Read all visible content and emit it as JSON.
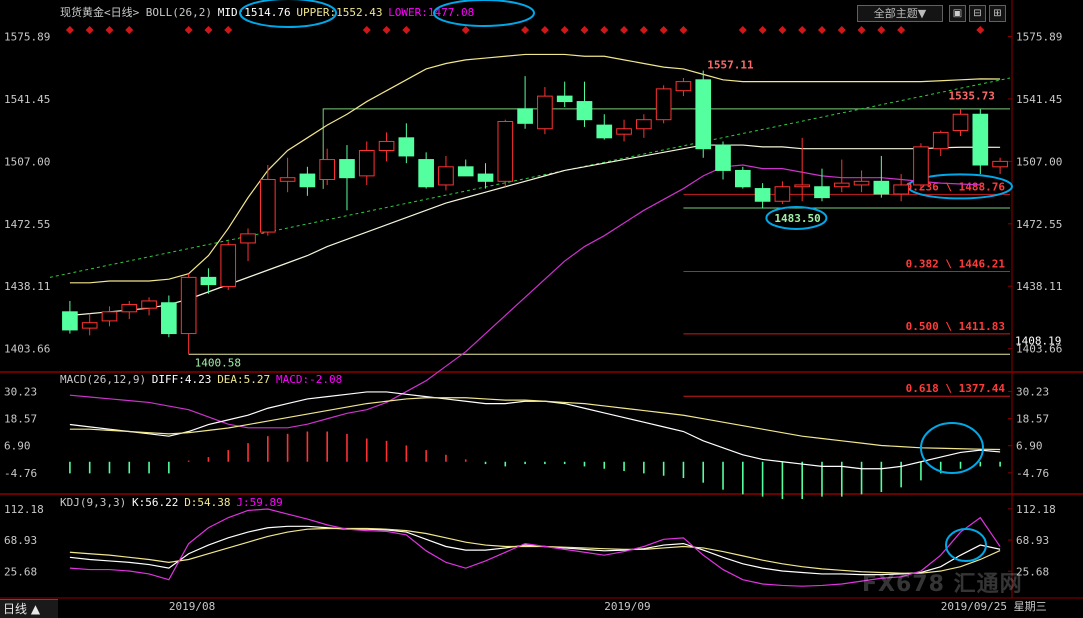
{
  "window": {
    "theme_button": "全部主题▼",
    "period_tab": "日线 ▲",
    "watermark": "FX678 汇通网"
  },
  "chart_data": {
    "type": "candlestick",
    "instrument": "现货黄金",
    "period": "日线",
    "header": {
      "main": [
        "现货黄金<日线>",
        "BOLL(26,2)",
        "MID:1514.76",
        "UPPER:1552.43",
        "LOWER:1477.08"
      ],
      "macd": [
        "MACD(26,12,9)",
        "DIFF:4.23",
        "DEA:5.27",
        "MACD:-2.08"
      ],
      "kdj": [
        "KDJ(9,3,3)",
        "K:56.22",
        "D:54.38",
        "J:59.89"
      ]
    },
    "price_axis": {
      "ylim": [
        1393,
        1585
      ],
      "ticks": [
        1575.89,
        1541.45,
        1507.0,
        1472.55,
        1438.11,
        1403.66
      ],
      "tick_labels": [
        "1575.89",
        "1541.45",
        "1507.00",
        "1472.55",
        "1438.11",
        "1403.66"
      ]
    },
    "candles": [
      {
        "o": 1424.0,
        "h": 1430.0,
        "l": 1412.0,
        "c": 1414.0
      },
      {
        "o": 1415.0,
        "h": 1423.0,
        "l": 1411.0,
        "c": 1418.0
      },
      {
        "o": 1419.0,
        "h": 1427.0,
        "l": 1416.0,
        "c": 1424.0
      },
      {
        "o": 1424.0,
        "h": 1430.0,
        "l": 1420.0,
        "c": 1428.0
      },
      {
        "o": 1426.0,
        "h": 1432.0,
        "l": 1422.0,
        "c": 1430.0
      },
      {
        "o": 1429.0,
        "h": 1433.0,
        "l": 1410.0,
        "c": 1412.0
      },
      {
        "o": 1412.0,
        "h": 1445.0,
        "l": 1400.6,
        "c": 1443.0
      },
      {
        "o": 1443.0,
        "h": 1448.0,
        "l": 1434.0,
        "c": 1439.0
      },
      {
        "o": 1438.0,
        "h": 1463.0,
        "l": 1436.0,
        "c": 1461.0
      },
      {
        "o": 1462.0,
        "h": 1470.0,
        "l": 1452.0,
        "c": 1467.0
      },
      {
        "o": 1468.0,
        "h": 1505.0,
        "l": 1466.0,
        "c": 1497.0
      },
      {
        "o": 1496.0,
        "h": 1509.0,
        "l": 1490.0,
        "c": 1498.0
      },
      {
        "o": 1500.0,
        "h": 1504.0,
        "l": 1488.0,
        "c": 1493.0
      },
      {
        "o": 1497.0,
        "h": 1514.0,
        "l": 1494.0,
        "c": 1508.0
      },
      {
        "o": 1508.0,
        "h": 1516.0,
        "l": 1480.0,
        "c": 1498.0
      },
      {
        "o": 1499.0,
        "h": 1518.0,
        "l": 1494.0,
        "c": 1513.0
      },
      {
        "o": 1513.0,
        "h": 1523.0,
        "l": 1507.0,
        "c": 1518.0
      },
      {
        "o": 1520.0,
        "h": 1528.0,
        "l": 1506.0,
        "c": 1510.0
      },
      {
        "o": 1508.0,
        "h": 1512.0,
        "l": 1492.0,
        "c": 1493.0
      },
      {
        "o": 1494.0,
        "h": 1510.0,
        "l": 1491.0,
        "c": 1504.0
      },
      {
        "o": 1504.0,
        "h": 1508.0,
        "l": 1499.0,
        "c": 1499.0
      },
      {
        "o": 1500.0,
        "h": 1506.0,
        "l": 1492.0,
        "c": 1496.0
      },
      {
        "o": 1496.0,
        "h": 1530.0,
        "l": 1493.0,
        "c": 1529.0
      },
      {
        "o": 1536.0,
        "h": 1554.0,
        "l": 1525.0,
        "c": 1528.0
      },
      {
        "o": 1525.0,
        "h": 1548.0,
        "l": 1522.0,
        "c": 1543.0
      },
      {
        "o": 1543.0,
        "h": 1551.0,
        "l": 1537.0,
        "c": 1540.0
      },
      {
        "o": 1540.0,
        "h": 1551.0,
        "l": 1526.0,
        "c": 1530.0
      },
      {
        "o": 1527.0,
        "h": 1533.0,
        "l": 1519.0,
        "c": 1520.0
      },
      {
        "o": 1522.0,
        "h": 1530.0,
        "l": 1518.0,
        "c": 1525.0
      },
      {
        "o": 1525.0,
        "h": 1533.0,
        "l": 1520.0,
        "c": 1530.0
      },
      {
        "o": 1530.0,
        "h": 1549.0,
        "l": 1528.0,
        "c": 1547.0
      },
      {
        "o": 1546.0,
        "h": 1553.0,
        "l": 1543.0,
        "c": 1551.0
      },
      {
        "o": 1552.0,
        "h": 1557.1,
        "l": 1509.0,
        "c": 1514.0
      },
      {
        "o": 1516.0,
        "h": 1518.0,
        "l": 1497.0,
        "c": 1502.0
      },
      {
        "o": 1502.0,
        "h": 1504.0,
        "l": 1492.0,
        "c": 1493.0
      },
      {
        "o": 1492.0,
        "h": 1495.0,
        "l": 1481.0,
        "c": 1485.0
      },
      {
        "o": 1485.0,
        "h": 1496.0,
        "l": 1483.5,
        "c": 1493.0
      },
      {
        "o": 1493.0,
        "h": 1520.0,
        "l": 1485.0,
        "c": 1494.0
      },
      {
        "o": 1493.0,
        "h": 1503.0,
        "l": 1485.0,
        "c": 1487.0
      },
      {
        "o": 1493.0,
        "h": 1508.0,
        "l": 1490.0,
        "c": 1495.0
      },
      {
        "o": 1494.0,
        "h": 1502.0,
        "l": 1490.0,
        "c": 1496.0
      },
      {
        "o": 1496.0,
        "h": 1510.0,
        "l": 1487.0,
        "c": 1489.0
      },
      {
        "o": 1489.0,
        "h": 1500.0,
        "l": 1485.0,
        "c": 1494.0
      },
      {
        "o": 1494.0,
        "h": 1517.0,
        "l": 1492.0,
        "c": 1515.0
      },
      {
        "o": 1514.0,
        "h": 1524.0,
        "l": 1510.0,
        "c": 1523.0
      },
      {
        "o": 1524.0,
        "h": 1535.7,
        "l": 1521.0,
        "c": 1533.0
      },
      {
        "o": 1533.0,
        "h": 1536.0,
        "l": 1500.0,
        "c": 1505.0
      },
      {
        "o": 1504.0,
        "h": 1509.0,
        "l": 1500.0,
        "c": 1507.0
      }
    ],
    "boll": {
      "mid": [
        1422,
        1423,
        1424,
        1425,
        1426,
        1428,
        1431,
        1435,
        1439,
        1443,
        1447,
        1451,
        1455,
        1460,
        1464,
        1468,
        1472,
        1476,
        1480,
        1484,
        1487,
        1490,
        1493,
        1496,
        1499,
        1502,
        1504,
        1506,
        1508,
        1510,
        1512,
        1514,
        1516,
        1516,
        1516,
        1515,
        1515,
        1514,
        1514,
        1514,
        1514,
        1514,
        1514,
        1514,
        1514.5,
        1514.8,
        1514.8,
        1514.76
      ],
      "upper": [
        1440,
        1440,
        1441,
        1441,
        1441,
        1442,
        1445,
        1455,
        1470,
        1487,
        1502,
        1513,
        1520,
        1527,
        1533,
        1540,
        1546,
        1552,
        1558,
        1561,
        1563,
        1564,
        1565,
        1566,
        1566,
        1566,
        1565,
        1565,
        1563,
        1561,
        1559,
        1558,
        1555,
        1552,
        1551,
        1551,
        1551,
        1551,
        1551,
        1551,
        1551,
        1551,
        1551,
        1551,
        1551.5,
        1552,
        1552.5,
        1552.43
      ],
      "lower": [
        1378,
        1377,
        1376,
        1375,
        1374,
        1372,
        1370,
        1366,
        1362,
        1360,
        1360,
        1360,
        1362,
        1365,
        1368,
        1370,
        1374,
        1380,
        1386,
        1394,
        1402,
        1412,
        1422,
        1432,
        1442,
        1452,
        1460,
        1466,
        1473,
        1480,
        1486,
        1492,
        1499,
        1504,
        1505,
        1503,
        1503,
        1501,
        1499,
        1498,
        1498,
        1498,
        1497,
        1496,
        1495,
        1494.5,
        1494,
        1477.08
      ]
    },
    "boll_lower_display_offset": 0,
    "annotations": {
      "high": {
        "label": "1557.11",
        "value": 1557.11,
        "bar": 32
      },
      "swing_high": {
        "label": "1535.73",
        "value": 1535.73,
        "bar": 45
      },
      "low": {
        "label": "1400.58",
        "value": 1400.58,
        "bar": 6
      },
      "swing_low": {
        "label": "1483.50",
        "value": 1483.5,
        "bar": 36
      },
      "current_price": {
        "label": "1408.19",
        "value": 1408.19
      },
      "fib_levels": [
        {
          "label": "0.236 \\ 1488.76",
          "value": 1488.76
        },
        {
          "label": "0.382 \\ 1446.21",
          "value": 1446.21
        },
        {
          "label": "0.500 \\ 1411.83",
          "value": 1411.83
        },
        {
          "label": "0.618 \\ 1377.44",
          "value": 1377.44
        }
      ],
      "box_top": 1536.0,
      "box_bottom": 1483.5,
      "trendline": [
        [
          0,
          1443.0
        ],
        [
          47,
          1553.0
        ]
      ]
    },
    "macd_axis": {
      "ylim": [
        -13,
        36
      ],
      "ticks": [
        30.23,
        18.57,
        6.9,
        -4.76
      ],
      "tick_labels": [
        "30.23",
        "18.57",
        "6.90",
        "-4.76"
      ]
    },
    "macd": {
      "diff": [
        16,
        15,
        14,
        13,
        12,
        11,
        13,
        16,
        18,
        20,
        23,
        25,
        27,
        28,
        29,
        30,
        30,
        29,
        28,
        27,
        26,
        25,
        25,
        26,
        26,
        25,
        23,
        21,
        19,
        17,
        15,
        13,
        9,
        6,
        3,
        1,
        0,
        -1,
        -2,
        -2,
        -3,
        -3,
        -2,
        0,
        2,
        4,
        5,
        4.23
      ],
      "dea": [
        14,
        14,
        13.5,
        13,
        12.5,
        12,
        12.5,
        13.5,
        14.5,
        16,
        17.5,
        19,
        20.5,
        22,
        23.5,
        25,
        26,
        27,
        27.5,
        27.5,
        27.5,
        27,
        26.5,
        26.5,
        26,
        25.5,
        25,
        24,
        23,
        22,
        21,
        20,
        18.5,
        17,
        15.5,
        14,
        12.5,
        11,
        10,
        9,
        8,
        7,
        6.5,
        6,
        5.8,
        5.6,
        5.4,
        5.27
      ],
      "hist": [
        -5,
        -5,
        -5,
        -5,
        -5,
        -5,
        0.5,
        2,
        5,
        8,
        11,
        12,
        13,
        13,
        12,
        10,
        9,
        7,
        5,
        3,
        1,
        -1,
        -2,
        -1,
        -1,
        -1,
        -2,
        -3,
        -4,
        -5,
        -6,
        -7,
        -9,
        -12,
        -14,
        -15,
        -16,
        -16,
        -15,
        -15,
        -14,
        -13,
        -11,
        -8,
        -5,
        -3,
        -2,
        -2.08
      ]
    },
    "kdj_axis": {
      "ylim": [
        -10,
        130
      ],
      "ticks": [
        112.18,
        68.93,
        25.68
      ],
      "tick_labels": [
        "112.18",
        "68.93",
        "25.68"
      ]
    },
    "kdj": {
      "k": [
        45,
        42,
        40,
        38,
        35,
        30,
        50,
        62,
        72,
        80,
        86,
        88,
        88,
        86,
        84,
        84,
        83,
        80,
        70,
        60,
        55,
        55,
        58,
        62,
        60,
        58,
        56,
        54,
        55,
        57,
        62,
        64,
        55,
        45,
        36,
        30,
        26,
        24,
        22,
        22,
        21,
        21,
        22,
        24,
        32,
        48,
        62,
        56.22
      ],
      "d": [
        52,
        50,
        48,
        45,
        42,
        38,
        42,
        50,
        58,
        66,
        74,
        80,
        84,
        85,
        85,
        85,
        84,
        82,
        78,
        72,
        66,
        62,
        60,
        60,
        60,
        59,
        58,
        57,
        56,
        56,
        58,
        60,
        58,
        53,
        47,
        41,
        36,
        32,
        29,
        27,
        25,
        24,
        23,
        23,
        26,
        32,
        42,
        54.38
      ],
      "j": [
        30,
        28,
        28,
        26,
        22,
        14,
        64,
        86,
        100,
        110,
        112,
        105,
        98,
        90,
        84,
        82,
        81,
        76,
        54,
        38,
        30,
        40,
        52,
        64,
        60,
        56,
        52,
        48,
        53,
        60,
        70,
        72,
        48,
        28,
        14,
        8,
        6,
        5,
        6,
        8,
        12,
        16,
        18,
        26,
        48,
        80,
        100,
        59.89
      ]
    },
    "x_labels": [
      {
        "bar": 5,
        "label": "2019/08"
      },
      {
        "bar": 27,
        "label": "2019/09"
      },
      {
        "bar": 44,
        "label": "2019/09/25 星期三"
      }
    ]
  }
}
